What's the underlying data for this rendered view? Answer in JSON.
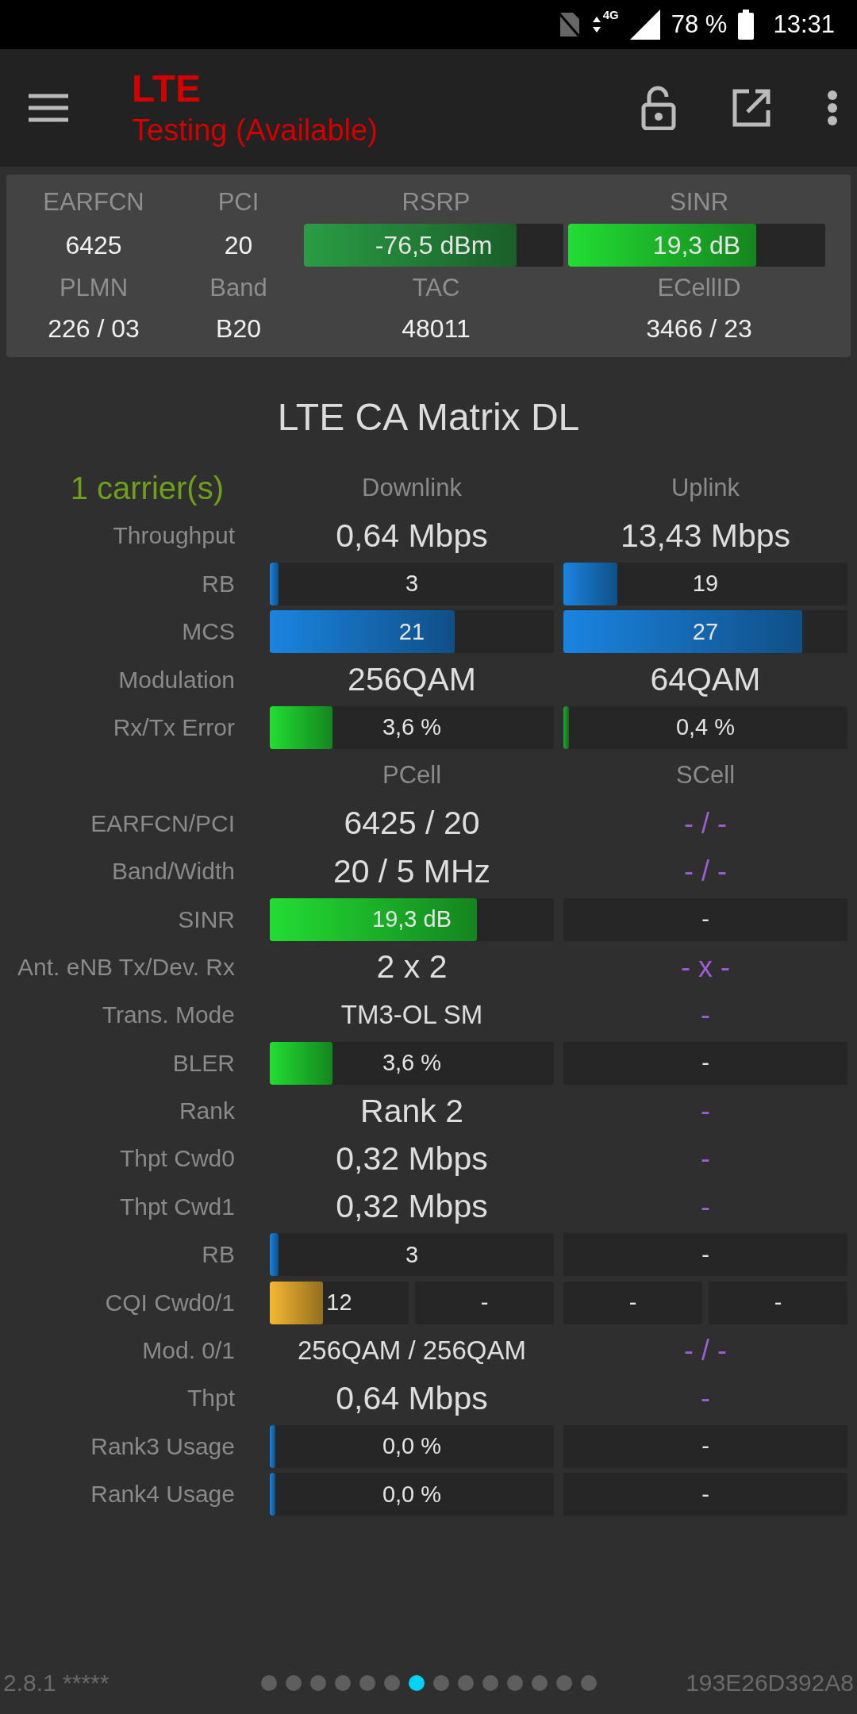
{
  "status_bar": {
    "network": "4G",
    "battery": "78 %",
    "time": "13:31"
  },
  "toolbar": {
    "title": "LTE",
    "subtitle": "Testing (Available)"
  },
  "info_card": {
    "fields": [
      {
        "label": "EARFCN",
        "kind": "text",
        "value": "6425"
      },
      {
        "label": "PCI",
        "kind": "text",
        "value": "20"
      },
      {
        "label": "RSRP",
        "kind": "bar",
        "value": "-76,5 dBm",
        "level": 0.82,
        "color": "#2a9d44"
      },
      {
        "label": "SINR",
        "kind": "bar",
        "value": "19,3 dB",
        "level": 0.73,
        "color": "#22dd33"
      },
      {
        "label": "PLMN",
        "kind": "text",
        "value": "226 / 03"
      },
      {
        "label": "Band",
        "kind": "text",
        "value": "B20"
      },
      {
        "label": "TAC",
        "kind": "text",
        "value": "48011"
      },
      {
        "label": "ECellID",
        "kind": "text",
        "value": "3466 / 23"
      }
    ]
  },
  "matrix": {
    "title": "LTE CA Matrix DL",
    "rows": [
      {
        "carriers": "1 carrier(s)",
        "cells": [
          {
            "kind": "heading",
            "text": "Downlink"
          },
          {
            "kind": "heading",
            "text": "Uplink"
          }
        ]
      },
      {
        "label": "Throughput",
        "cells": [
          {
            "kind": "value",
            "text": "0,64 Mbps"
          },
          {
            "kind": "value",
            "text": "13,43 Mbps"
          }
        ]
      },
      {
        "label": "RB",
        "cells": [
          {
            "kind": "bar",
            "text": "3",
            "level": 0.03,
            "color": "#1a84e0"
          },
          {
            "kind": "bar",
            "text": "19",
            "level": 0.19,
            "color": "#1a84e0"
          }
        ]
      },
      {
        "label": "MCS",
        "cells": [
          {
            "kind": "bar",
            "text": "21",
            "level": 0.65,
            "color": "#1a84e0"
          },
          {
            "kind": "bar",
            "text": "27",
            "level": 0.84,
            "color": "#1a84e0"
          }
        ]
      },
      {
        "label": "Modulation",
        "cells": [
          {
            "kind": "value",
            "text": "256QAM"
          },
          {
            "kind": "value",
            "text": "64QAM"
          }
        ]
      },
      {
        "label": "Rx/Tx Error",
        "cells": [
          {
            "kind": "bar",
            "text": "3,6 %",
            "level": 0.22,
            "color": "#22dd33"
          },
          {
            "kind": "bar",
            "text": "0,4 %",
            "level": 0.02,
            "color": "#22aa33"
          }
        ]
      },
      {
        "cells": [
          {
            "kind": "heading",
            "text": "PCell"
          },
          {
            "kind": "heading",
            "text": "SCell"
          }
        ]
      },
      {
        "label": "EARFCN/PCI",
        "cells": [
          {
            "kind": "value",
            "text": "6425 / 20"
          },
          {
            "kind": "na",
            "text": "- / -"
          }
        ]
      },
      {
        "label": "Band/Width",
        "cells": [
          {
            "kind": "value",
            "text": "20 / 5 MHz"
          },
          {
            "kind": "na",
            "text": "- / -"
          }
        ]
      },
      {
        "label": "SINR",
        "cells": [
          {
            "kind": "bar",
            "text": "19,3 dB",
            "level": 0.73,
            "color": "#22dd33"
          },
          {
            "kind": "slot",
            "text": "-"
          }
        ]
      },
      {
        "label": "Ant. eNB Tx/Dev. Rx",
        "cells": [
          {
            "kind": "value",
            "text": "2 x 2"
          },
          {
            "kind": "na",
            "text": "- x -"
          }
        ]
      },
      {
        "label": "Trans. Mode",
        "cells": [
          {
            "kind": "value-small",
            "text": "TM3-OL SM"
          },
          {
            "kind": "na",
            "text": "-"
          }
        ]
      },
      {
        "label": "BLER",
        "cells": [
          {
            "kind": "bar",
            "text": "3,6 %",
            "level": 0.22,
            "color": "#22dd33"
          },
          {
            "kind": "slot",
            "text": "-"
          }
        ]
      },
      {
        "label": "Rank",
        "cells": [
          {
            "kind": "value",
            "text": "Rank 2"
          },
          {
            "kind": "na",
            "text": "-"
          }
        ]
      },
      {
        "label": "Thpt Cwd0",
        "cells": [
          {
            "kind": "value",
            "text": "0,32 Mbps"
          },
          {
            "kind": "na",
            "text": "-"
          }
        ]
      },
      {
        "label": "Thpt Cwd1",
        "cells": [
          {
            "kind": "value",
            "text": "0,32 Mbps"
          },
          {
            "kind": "na",
            "text": "-"
          }
        ]
      },
      {
        "label": "RB",
        "cells": [
          {
            "kind": "bar",
            "text": "3",
            "level": 0.03,
            "color": "#1a84e0"
          },
          {
            "kind": "slot",
            "text": "-"
          }
        ]
      },
      {
        "label": "CQI Cwd0/1",
        "cells": [
          {
            "kind": "split",
            "parts": [
              {
                "kind": "bar",
                "text": "12",
                "level": 0.38,
                "color": "#f5b731"
              },
              {
                "kind": "slot",
                "text": "-"
              }
            ]
          },
          {
            "kind": "split",
            "parts": [
              {
                "kind": "slot",
                "text": "-"
              },
              {
                "kind": "slot",
                "text": "-"
              }
            ]
          }
        ]
      },
      {
        "label": "Mod. 0/1",
        "cells": [
          {
            "kind": "value-small",
            "text": "256QAM / 256QAM"
          },
          {
            "kind": "na",
            "text": "- / -"
          }
        ]
      },
      {
        "label": "Thpt",
        "cells": [
          {
            "kind": "value",
            "text": "0,64 Mbps"
          },
          {
            "kind": "na",
            "text": "-"
          }
        ]
      },
      {
        "label": "Rank3 Usage",
        "cells": [
          {
            "kind": "bar",
            "text": "0,0 %",
            "level": 0.02,
            "color": "#1a84e0"
          },
          {
            "kind": "slot",
            "text": "-"
          }
        ]
      },
      {
        "label": "Rank4 Usage",
        "cells": [
          {
            "kind": "bar",
            "text": "0,0 %",
            "level": 0.02,
            "color": "#1a84e0"
          },
          {
            "kind": "slot",
            "text": "-"
          }
        ]
      }
    ]
  },
  "footer": {
    "version": "2.8.1 *****",
    "device_id": "193E26D392A8",
    "pages": [
      {
        "selected": false
      },
      {
        "selected": false
      },
      {
        "selected": false
      },
      {
        "selected": false
      },
      {
        "selected": false
      },
      {
        "selected": false
      },
      {
        "selected": true
      },
      {
        "selected": false
      },
      {
        "selected": false
      },
      {
        "selected": false
      },
      {
        "selected": false
      },
      {
        "selected": false
      },
      {
        "selected": false
      },
      {
        "selected": false
      }
    ]
  }
}
